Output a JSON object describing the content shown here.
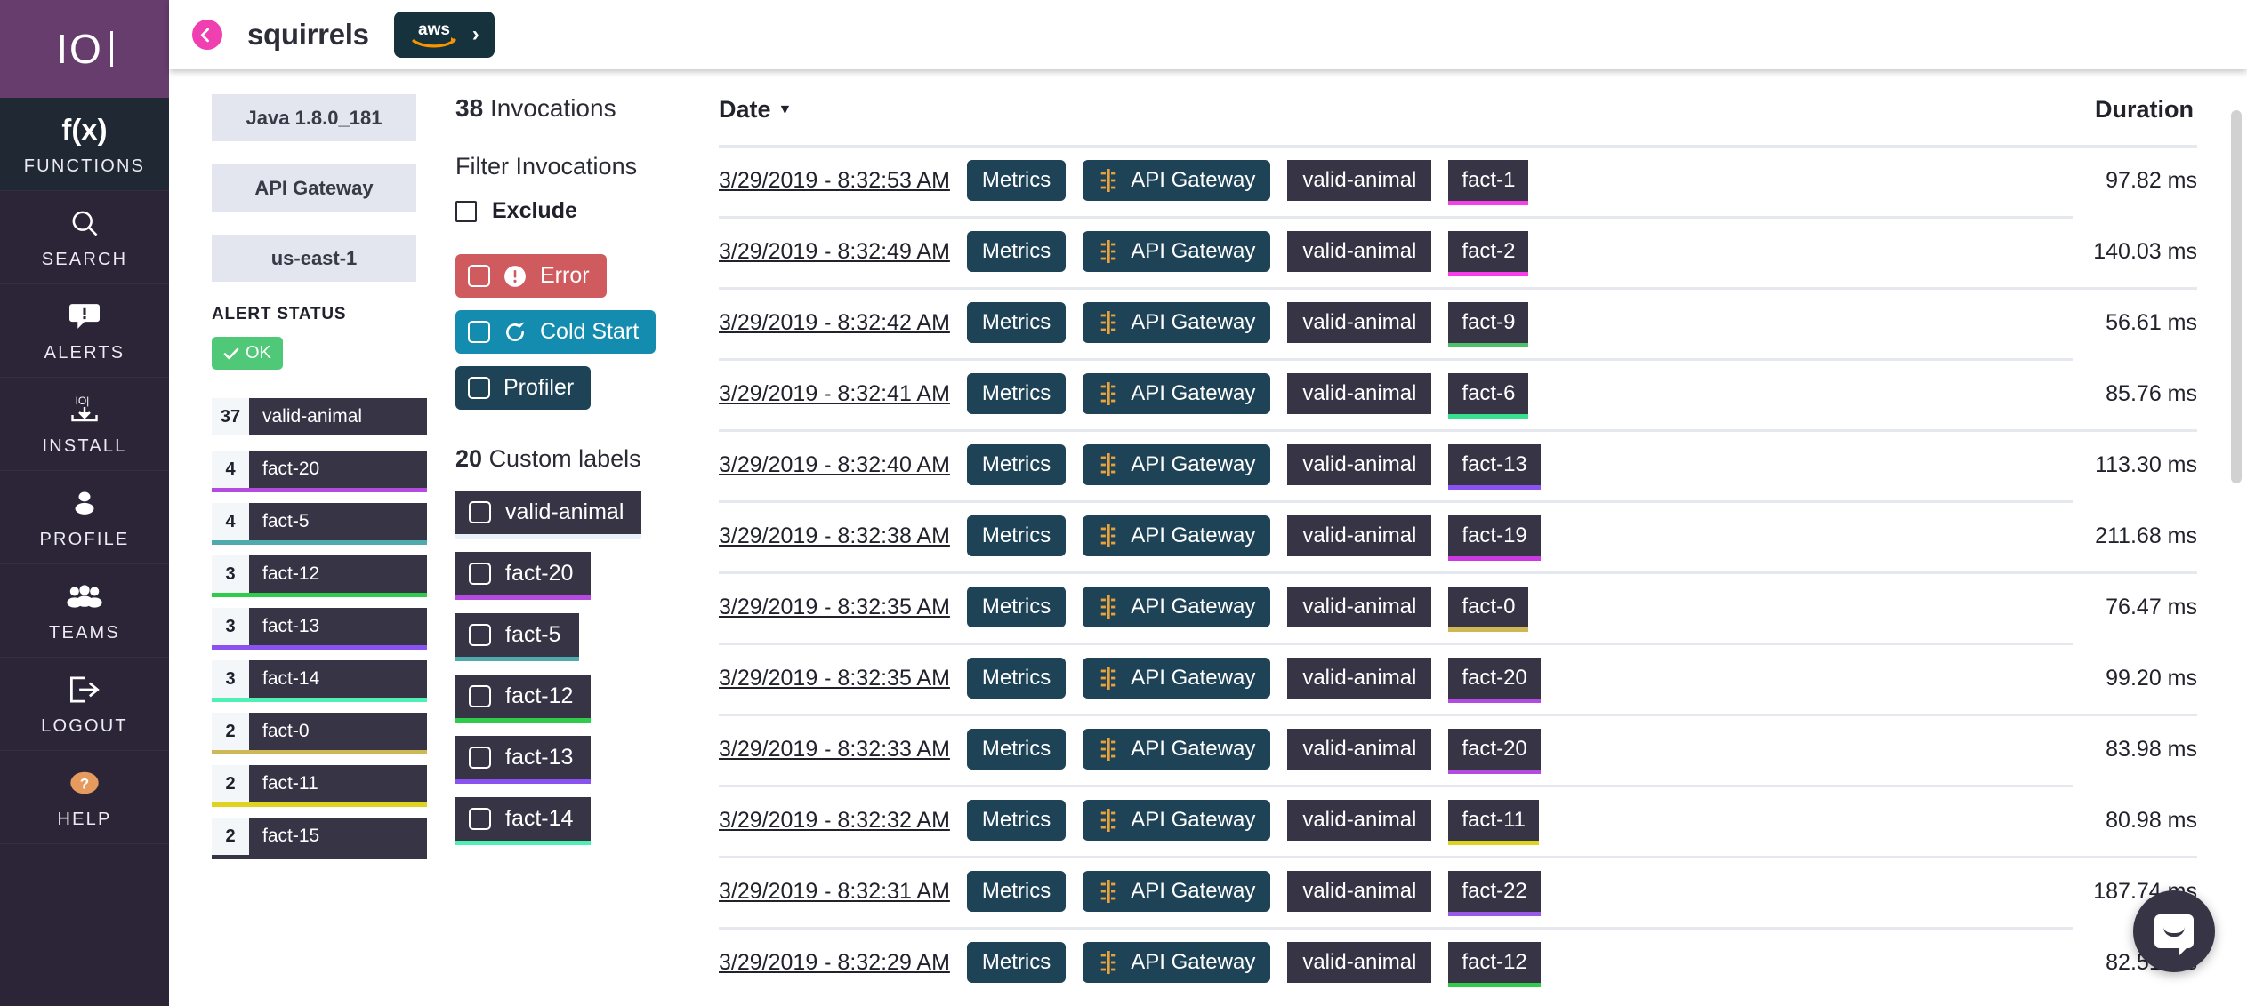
{
  "sidebar": {
    "logo": "IO",
    "items": [
      {
        "label": "FUNCTIONS",
        "icon": "fx-icon",
        "active": true
      },
      {
        "label": "SEARCH",
        "icon": "magnifier-icon",
        "active": false
      },
      {
        "label": "ALERTS",
        "icon": "alert-bubble-icon",
        "active": false
      },
      {
        "label": "INSTALL",
        "icon": "install-download-icon",
        "active": false
      },
      {
        "label": "PROFILE",
        "icon": "person-icon",
        "active": false
      },
      {
        "label": "TEAMS",
        "icon": "people-group-icon",
        "active": false
      },
      {
        "label": "LOGOUT",
        "icon": "logout-arrow-icon",
        "active": false
      },
      {
        "label": "HELP",
        "icon": "question-circle-icon",
        "active": false
      }
    ]
  },
  "header": {
    "back_icon": "chevron-left-icon",
    "title": "squirrels",
    "provider_chip": {
      "logo": "aws",
      "chevron": "›"
    }
  },
  "meta": {
    "runtime": "Java 1.8.0_181",
    "trigger": "API Gateway",
    "region": "us-east-1",
    "alert_status_title": "ALERT STATUS",
    "alert_status_value": "OK",
    "alert_status_icon": "check-icon",
    "alert_status_color": "#4fc878"
  },
  "label_counts": [
    {
      "count": "37",
      "label": "valid-animal",
      "color": "#eef3f7"
    },
    {
      "count": "4",
      "label": "fact-20",
      "color": "#b44ae0"
    },
    {
      "count": "4",
      "label": "fact-5",
      "color": "#4eaaad"
    },
    {
      "count": "3",
      "label": "fact-12",
      "color": "#2ecc4a"
    },
    {
      "count": "3",
      "label": "fact-13",
      "color": "#8a52f0"
    },
    {
      "count": "3",
      "label": "fact-14",
      "color": "#4ff0b4"
    },
    {
      "count": "2",
      "label": "fact-0",
      "color": "#cdb757"
    },
    {
      "count": "2",
      "label": "fact-11",
      "color": "#e0d320"
    },
    {
      "count": "2",
      "label": "fact-15",
      "color": "#373446"
    }
  ],
  "filters": {
    "invocations_count": "38",
    "invocations_word": "Invocations",
    "title": "Filter Invocations",
    "exclude_label": "Exclude",
    "buttons": [
      {
        "label": "Error",
        "icon": "exclamation-circle-icon",
        "color": "#d05b5f"
      },
      {
        "label": "Cold Start",
        "icon": "refresh-icon",
        "color": "#148cb0"
      },
      {
        "label": "Profiler",
        "icon": "none",
        "color": "#1e4256"
      }
    ],
    "custom_labels_count": "20",
    "custom_labels_word": "Custom labels",
    "custom_labels": [
      {
        "label": "valid-animal",
        "color": "#e8f1f7"
      },
      {
        "label": "fact-20",
        "color": "#b44ae0"
      },
      {
        "label": "fact-5",
        "color": "#4eaaad"
      },
      {
        "label": "fact-12",
        "color": "#2ecc4a"
      },
      {
        "label": "fact-13",
        "color": "#8a52f0"
      },
      {
        "label": "fact-14",
        "color": "#4ff0b4"
      }
    ]
  },
  "table": {
    "col_date": "Date",
    "sort_caret": "▼",
    "col_duration": "Duration",
    "metrics_label": "Metrics",
    "gateway_label": "API Gateway",
    "rows": [
      {
        "date": "3/29/2019 - 8:32:53 AM",
        "metrics": "Metrics",
        "gateway": "API Gateway",
        "animal": "valid-animal",
        "fact": "fact-1",
        "fact_color": "#f53fe8",
        "duration": "97.82 ms"
      },
      {
        "date": "3/29/2019 - 8:32:49 AM",
        "metrics": "Metrics",
        "gateway": "API Gateway",
        "animal": "valid-animal",
        "fact": "fact-2",
        "fact_color": "#f53fe8",
        "duration": "140.03 ms"
      },
      {
        "date": "3/29/2019 - 8:32:42 AM",
        "metrics": "Metrics",
        "gateway": "API Gateway",
        "animal": "valid-animal",
        "fact": "fact-9",
        "fact_color": "#4fc06a",
        "duration": "56.61 ms"
      },
      {
        "date": "3/29/2019 - 8:32:41 AM",
        "metrics": "Metrics",
        "gateway": "API Gateway",
        "animal": "valid-animal",
        "fact": "fact-6",
        "fact_color": "#35e08f",
        "duration": "85.76 ms"
      },
      {
        "date": "3/29/2019 - 8:32:40 AM",
        "metrics": "Metrics",
        "gateway": "API Gateway",
        "animal": "valid-animal",
        "fact": "fact-13",
        "fact_color": "#8a52f0",
        "duration": "113.30 ms"
      },
      {
        "date": "3/29/2019 - 8:32:38 AM",
        "metrics": "Metrics",
        "gateway": "API Gateway",
        "animal": "valid-animal",
        "fact": "fact-19",
        "fact_color": "#cb3ae0",
        "duration": "211.68 ms"
      },
      {
        "date": "3/29/2019 - 8:32:35 AM",
        "metrics": "Metrics",
        "gateway": "API Gateway",
        "animal": "valid-animal",
        "fact": "fact-0",
        "fact_color": "#cdb757",
        "duration": "76.47 ms"
      },
      {
        "date": "3/29/2019 - 8:32:35 AM",
        "metrics": "Metrics",
        "gateway": "API Gateway",
        "animal": "valid-animal",
        "fact": "fact-20",
        "fact_color": "#b44ae0",
        "duration": "99.20 ms"
      },
      {
        "date": "3/29/2019 - 8:32:33 AM",
        "metrics": "Metrics",
        "gateway": "API Gateway",
        "animal": "valid-animal",
        "fact": "fact-20",
        "fact_color": "#b44ae0",
        "duration": "83.98 ms"
      },
      {
        "date": "3/29/2019 - 8:32:32 AM",
        "metrics": "Metrics",
        "gateway": "API Gateway",
        "animal": "valid-animal",
        "fact": "fact-11",
        "fact_color": "#e0d320",
        "duration": "80.98 ms"
      },
      {
        "date": "3/29/2019 - 8:32:31 AM",
        "metrics": "Metrics",
        "gateway": "API Gateway",
        "animal": "valid-animal",
        "fact": "fact-22",
        "fact_color": "#9a5ae8",
        "duration": "187.74 ms"
      },
      {
        "date": "3/29/2019 - 8:32:29 AM",
        "metrics": "Metrics",
        "gateway": "API Gateway",
        "animal": "valid-animal",
        "fact": "fact-12",
        "fact_color": "#2ecc4a",
        "duration": "82.51 ms"
      }
    ]
  },
  "support": {
    "icon": "chat-bubble-icon"
  }
}
